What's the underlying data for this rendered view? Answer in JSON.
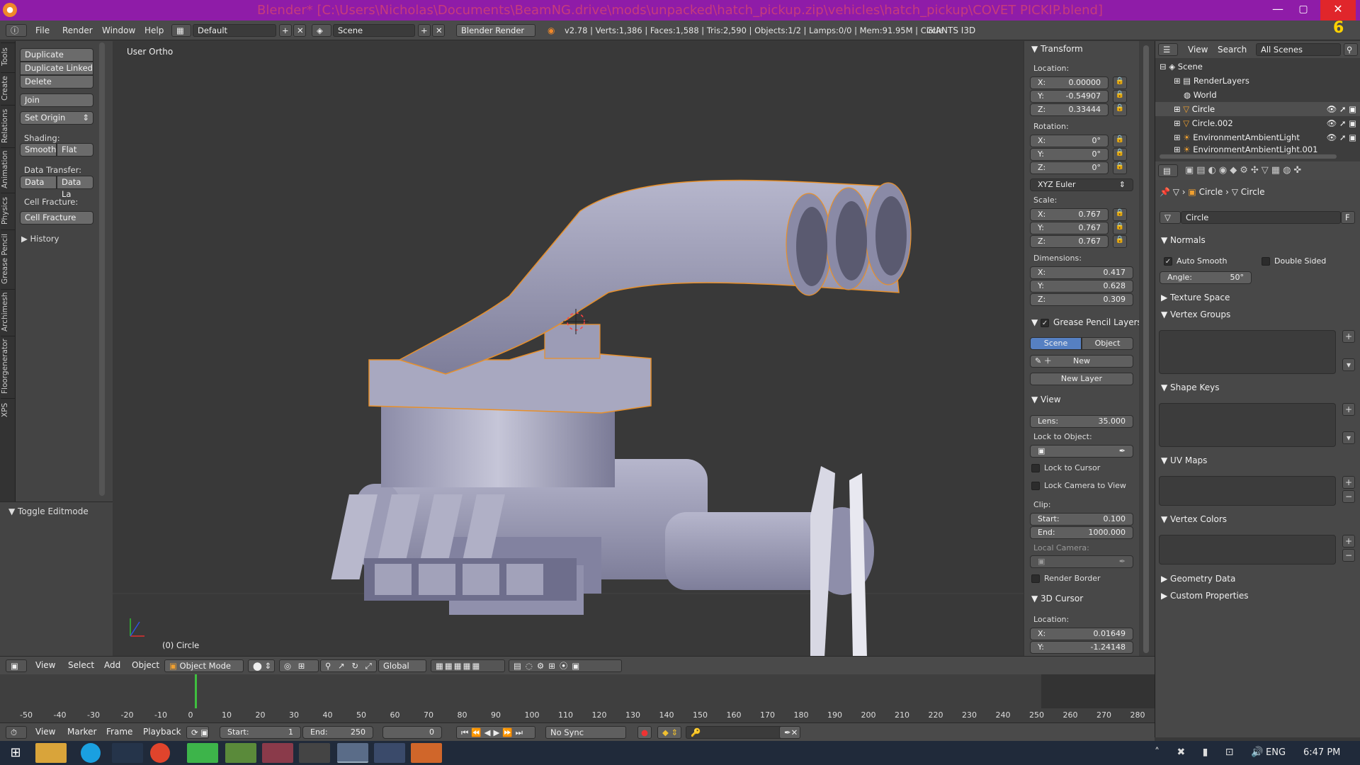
{
  "window": {
    "title": "Blender* [C:\\Users\\Nicholas\\Documents\\BeamNG.drive\\mods\\unpacked\\hatch_pickup.zip\\vehicles\\hatch_pickup\\COVET PICKIP.blend]",
    "minimize": "—",
    "maximize": "▢",
    "close": "✕"
  },
  "menubar": {
    "items": [
      "File",
      "Render",
      "Window",
      "Help"
    ],
    "layout": "Default",
    "scene": "Scene",
    "engine": "Blender Render",
    "stats": "v2.78 | Verts:1,386 | Faces:1,588 | Tris:2,590 | Objects:1/2 | Lamps:0/0 | Mem:91.95M | Circle",
    "plugin": "GIANTS I3D"
  },
  "left_tabs": [
    "Tools",
    "Create",
    "Relations",
    "Animation",
    "Physics",
    "Grease Pencil",
    "Archimesh",
    "Floorgenerator",
    "XPS"
  ],
  "tool_shelf": {
    "buttons": [
      "Duplicate",
      "Duplicate Linked",
      "Delete",
      "Join"
    ],
    "set_origin": "Set Origin",
    "shading_label": "Shading:",
    "smooth": "Smooth",
    "flat": "Flat",
    "data_transfer_label": "Data Transfer:",
    "data": "Data",
    "data_la": "Data La",
    "cell_fracture_label": "Cell Fracture:",
    "cell_fracture": "Cell Fracture",
    "history": "History",
    "toggle_editmode": "Toggle Editmode"
  },
  "viewport": {
    "view_name": "User Ortho",
    "object_label": "(0) Circle"
  },
  "npanel": {
    "transform": "Transform",
    "location_label": "Location:",
    "location": [
      [
        "X:",
        "0.00000"
      ],
      [
        "Y:",
        "-0.54907"
      ],
      [
        "Z:",
        "0.33444"
      ]
    ],
    "rotation_label": "Rotation:",
    "rotation": [
      [
        "X:",
        "0°"
      ],
      [
        "Y:",
        "0°"
      ],
      [
        "Z:",
        "0°"
      ]
    ],
    "rotation_mode": "XYZ Euler",
    "scale_label": "Scale:",
    "scale": [
      [
        "X:",
        "0.767"
      ],
      [
        "Y:",
        "0.767"
      ],
      [
        "Z:",
        "0.767"
      ]
    ],
    "dimensions_label": "Dimensions:",
    "dimensions": [
      [
        "X:",
        "0.417"
      ],
      [
        "Y:",
        "0.628"
      ],
      [
        "Z:",
        "0.309"
      ]
    ],
    "grease_pencil_layers": "Grease Pencil Layers",
    "gp_scene": "Scene",
    "gp_object": "Object",
    "gp_new": "New",
    "gp_new_layer": "New Layer",
    "view": "View",
    "lens_label": "Lens:",
    "lens": "35.000",
    "lock_to_object": "Lock to Object:",
    "lock_to_cursor": "Lock to Cursor",
    "lock_camera": "Lock Camera to View",
    "clip_label": "Clip:",
    "clip_start_label": "Start:",
    "clip_start": "0.100",
    "clip_end_label": "End:",
    "clip_end": "1000.000",
    "local_camera": "Local Camera:",
    "render_border": "Render Border",
    "cursor": "3D Cursor",
    "cursor_location_label": "Location:",
    "cursor_location": [
      [
        "X:",
        "0.01649"
      ],
      [
        "Y:",
        "-1.24148"
      ]
    ]
  },
  "outliner": {
    "view": "View",
    "search": "Search",
    "filter": "All Scenes",
    "items": [
      "Scene",
      "RenderLayers",
      "World",
      "Circle",
      "Circle.002",
      "EnvironmentAmbientLight",
      "EnvironmentAmbientLight.001"
    ]
  },
  "properties": {
    "breadcrumb_object": "Circle",
    "breadcrumb_mesh": "Circle",
    "mesh_name": "Circle",
    "fake_user": "F",
    "normals": "Normals",
    "auto_smooth": "Auto Smooth",
    "double_sided": "Double Sided",
    "angle_label": "Angle:",
    "angle": "50°",
    "texture_space": "Texture Space",
    "vertex_groups": "Vertex Groups",
    "shape_keys": "Shape Keys",
    "uv_maps": "UV Maps",
    "vertex_colors": "Vertex Colors",
    "geometry_data": "Geometry Data",
    "custom_properties": "Custom Properties"
  },
  "viewport_header": {
    "menus": [
      "View",
      "Select",
      "Add",
      "Object"
    ],
    "mode": "Object Mode",
    "orientation": "Global"
  },
  "timeline": {
    "ruler": [
      "-50",
      "-40",
      "-30",
      "-20",
      "-10",
      "0",
      "10",
      "20",
      "30",
      "40",
      "50",
      "60",
      "70",
      "80",
      "90",
      "100",
      "110",
      "120",
      "130",
      "140",
      "150",
      "160",
      "170",
      "180",
      "190",
      "200",
      "210",
      "220",
      "230",
      "240",
      "250",
      "260",
      "270",
      "280"
    ],
    "menus": [
      "View",
      "Marker",
      "Frame",
      "Playback"
    ],
    "start_label": "Start:",
    "start": "1",
    "end_label": "End:",
    "end": "250",
    "current": "0",
    "sync": "No Sync"
  },
  "taskbar": {
    "language": "ENG",
    "time": "6:47 PM"
  },
  "badge": "6"
}
